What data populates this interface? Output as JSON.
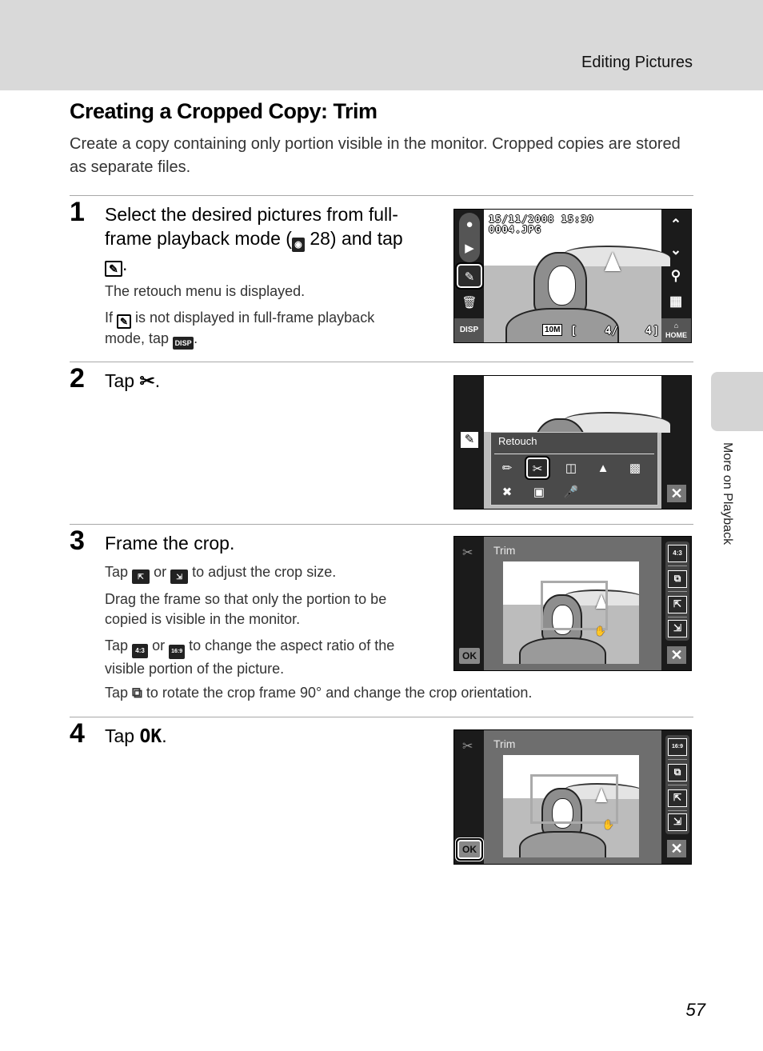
{
  "header": {
    "section": "Editing Pictures"
  },
  "title": "Creating a Cropped Copy: Trim",
  "intro": "Create a copy containing only portion visible in the monitor. Cropped copies are stored as separate files.",
  "side_tab": {
    "label": "More on Playback"
  },
  "page_number": "57",
  "steps": [
    {
      "number": "1",
      "title_parts": [
        "Select the desired pictures from full-frame playback mode (",
        "28) and tap",
        "."
      ],
      "notes": [
        "The retouch menu is displayed.",
        {
          "pre": "If",
          "post": "is not displayed in full-frame playback mode, tap",
          "end": "."
        }
      ],
      "icons": {
        "ref": "reference-icon",
        "edit": "retouch-edit-icon",
        "disp": "DISP"
      },
      "screen": {
        "date_time": "15/11/2008 15:30",
        "filename": "0004.JPG",
        "image_size": "10M",
        "counter": "4/    4",
        "left_buttons": [
          "shooting-mode-icon",
          "playback-mode-icon",
          "retouch-edit-icon",
          "delete-icon"
        ],
        "disp_label": "DISP",
        "right_buttons": [
          "up-arrow-icon",
          "down-arrow-icon",
          "zoom-icon",
          "thumbnail-icon"
        ],
        "home_label": "HOME"
      }
    },
    {
      "number": "2",
      "title_parts": [
        "Tap",
        "."
      ],
      "icons": {
        "trim": "scissors-icon"
      },
      "screen": {
        "menu_title": "Retouch",
        "menu_items": [
          "quick-retouch-icon",
          "trim-icon",
          "d-lighting-icon",
          "skin-softening-icon",
          "small-picture-icon",
          "paint-icon",
          "black-border-icon",
          "voice-memo-icon"
        ],
        "selected_item": "trim-icon"
      }
    },
    {
      "number": "3",
      "title": "Frame the crop.",
      "notes": [
        {
          "pre": "Tap",
          "mid": "or",
          "post": "to adjust the crop size."
        },
        "Drag the frame so that only the portion to be copied is visible in the monitor.",
        {
          "pre": "Tap",
          "mid": "or",
          "post": "to change the aspect ratio of the visible portion of the picture."
        },
        {
          "pre": "Tap",
          "post": "to rotate the crop frame 90° and change the crop orientation."
        }
      ],
      "icons": {
        "enlarge": "enlarge-crop-icon",
        "reduce": "reduce-crop-icon",
        "ratio_43": "4:3",
        "ratio_169": "16:9",
        "rotate": "rotate-frame-icon"
      },
      "screen": {
        "title": "Trim",
        "aspect_label": "4:3",
        "ok_label": "OK"
      }
    },
    {
      "number": "4",
      "title_parts": [
        "Tap",
        "."
      ],
      "ok_glyph": "OK",
      "screen": {
        "title": "Trim",
        "aspect_label": "16:9",
        "ok_label": "OK"
      }
    }
  ]
}
